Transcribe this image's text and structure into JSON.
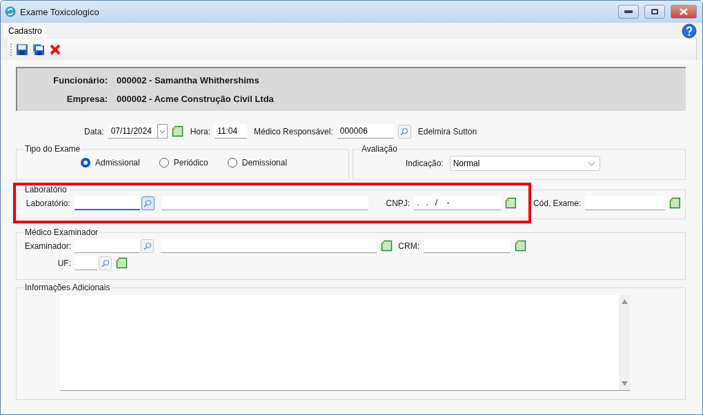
{
  "window": {
    "title": "Exame Toxicologico"
  },
  "tabs": [
    {
      "label": "Cadastro",
      "selected": true
    }
  ],
  "header": [
    {
      "label": "Funcionário:",
      "value": "000002 - Samantha Whithershims"
    },
    {
      "label": "Empresa:",
      "value": "000002 - Acme Construção Civil Ltda"
    }
  ],
  "date_row": {
    "data_label": "Data:",
    "data_value": "07/11/2024",
    "hora_label": "Hora:",
    "hora_value": "11:04",
    "medico_label": "Médico Responsável:",
    "medico_code": "000006",
    "medico_name": "Edelmira Sutton"
  },
  "tipo_exame": {
    "title": "Tipo do Exame",
    "options": [
      {
        "label": "Admissional",
        "selected": true
      },
      {
        "label": "Periódico",
        "selected": false
      },
      {
        "label": "Demissional",
        "selected": false
      }
    ]
  },
  "avaliacao": {
    "title": "Avaliação",
    "label": "Indicação:",
    "value": "Normal"
  },
  "laboratorio": {
    "title": "Laboratório",
    "label": "Laboratório:",
    "code_focused": true,
    "cnpj_label": "CNPJ:",
    "cnpj_mask": ".   .   /    -",
    "cod_exame_label": "Cód. Exame:"
  },
  "medico_examinador": {
    "title": "Médico Examinador",
    "examinador_label": "Examinador:",
    "crm_label": "CRM:",
    "uf_label": "UF:"
  },
  "informacoes": {
    "title": "Informações Adicionais"
  }
}
